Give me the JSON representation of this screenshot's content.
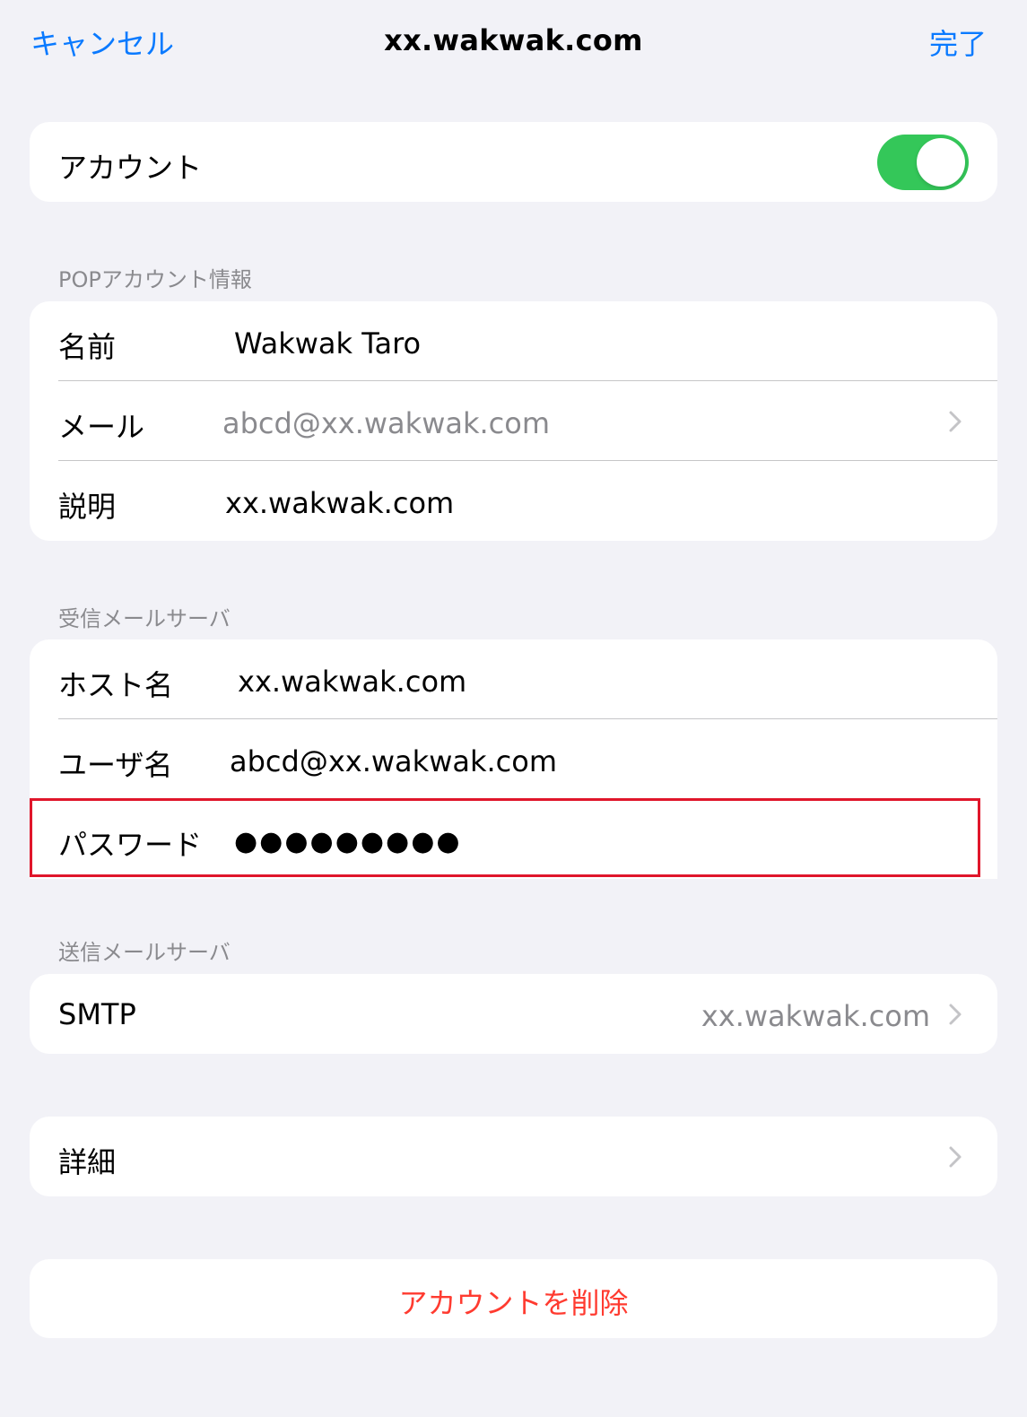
{
  "nav": {
    "cancel_label": "キャンセル",
    "title": "xx.wakwak.com",
    "done_label": "完了"
  },
  "account_toggle": {
    "label": "アカウント",
    "enabled": true
  },
  "pop_section": {
    "header": "POPアカウント情報",
    "rows": [
      {
        "label": "名前",
        "value": "Wakwak Taro"
      },
      {
        "label": "メール",
        "value": "abcd@xx.wakwak.com"
      },
      {
        "label": "説明",
        "value": "xx.wakwak.com"
      }
    ]
  },
  "incoming_section": {
    "header": "受信メールサーバ",
    "rows": [
      {
        "label": "ホスト名",
        "value": "xx.wakwak.com"
      },
      {
        "label": "ユーザ名",
        "value": "abcd@xx.wakwak.com"
      },
      {
        "label": "パスワード",
        "value": "●●●●●●●●●"
      }
    ]
  },
  "outgoing_section": {
    "header": "送信メールサーバ",
    "smtp_label": "SMTP",
    "smtp_value": "xx.wakwak.com"
  },
  "details_label": "詳細",
  "delete_label": "アカウントを削除",
  "colors": {
    "accent": "#0a7aff",
    "toggle_on": "#34c759",
    "destructive": "#ff3b30",
    "highlight": "#e0162b"
  }
}
